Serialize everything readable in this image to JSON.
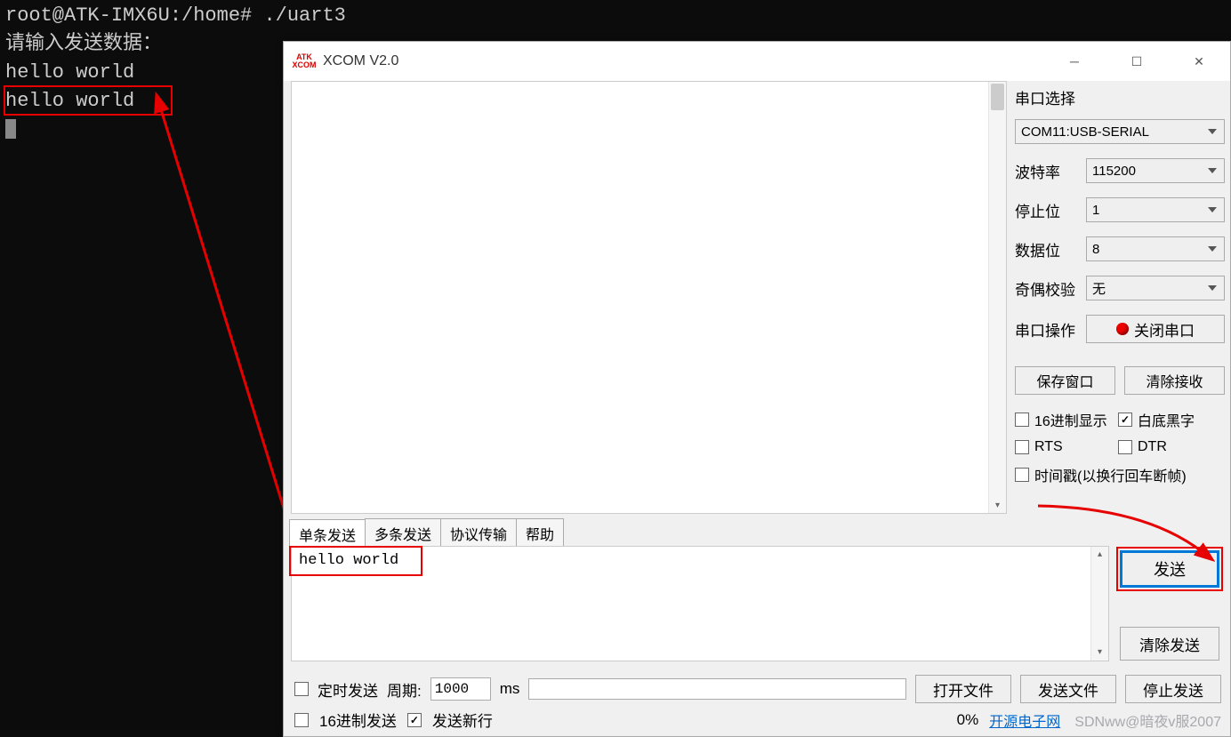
{
  "terminal": {
    "line1": "root@ATK-IMX6U:/home# ./uart3",
    "line2": "请输入发送数据：",
    "line3": "hello world",
    "line4": "hello world"
  },
  "xcom": {
    "title": "XCOM V2.0",
    "logo_top": "ATK",
    "logo_bottom": "XCOM",
    "panel": {
      "title": "串口选择",
      "port_value": "COM11:USB-SERIAL",
      "baud_label": "波特率",
      "baud_value": "115200",
      "stop_label": "停止位",
      "stop_value": "1",
      "data_label": "数据位",
      "data_value": "8",
      "parity_label": "奇偶校验",
      "parity_value": "无",
      "op_label": "串口操作",
      "op_btn": "关闭串口",
      "save_win": "保存窗口",
      "clear_recv": "清除接收",
      "hex_disp": "16进制显示",
      "bw": "白底黑字",
      "rts": "RTS",
      "dtr": "DTR",
      "timestamp": "时间戳(以换行回车断帧)"
    },
    "tabs": {
      "single": "单条发送",
      "multi": "多条发送",
      "proto": "协议传输",
      "help": "帮助"
    },
    "send": {
      "text": "hello world",
      "send_btn": "发送",
      "clear_btn": "清除发送"
    },
    "bottom": {
      "timed_send": "定时发送",
      "period_label": "周期:",
      "period_value": "1000",
      "period_unit": "ms",
      "open_file": "打开文件",
      "send_file": "发送文件",
      "stop_send": "停止发送",
      "hex_send": "16进制发送",
      "send_newline": "发送新行",
      "progress_pct": "0%",
      "link": "开源电子网",
      "watermark": "SDNww@暗夜v服2007"
    }
  }
}
